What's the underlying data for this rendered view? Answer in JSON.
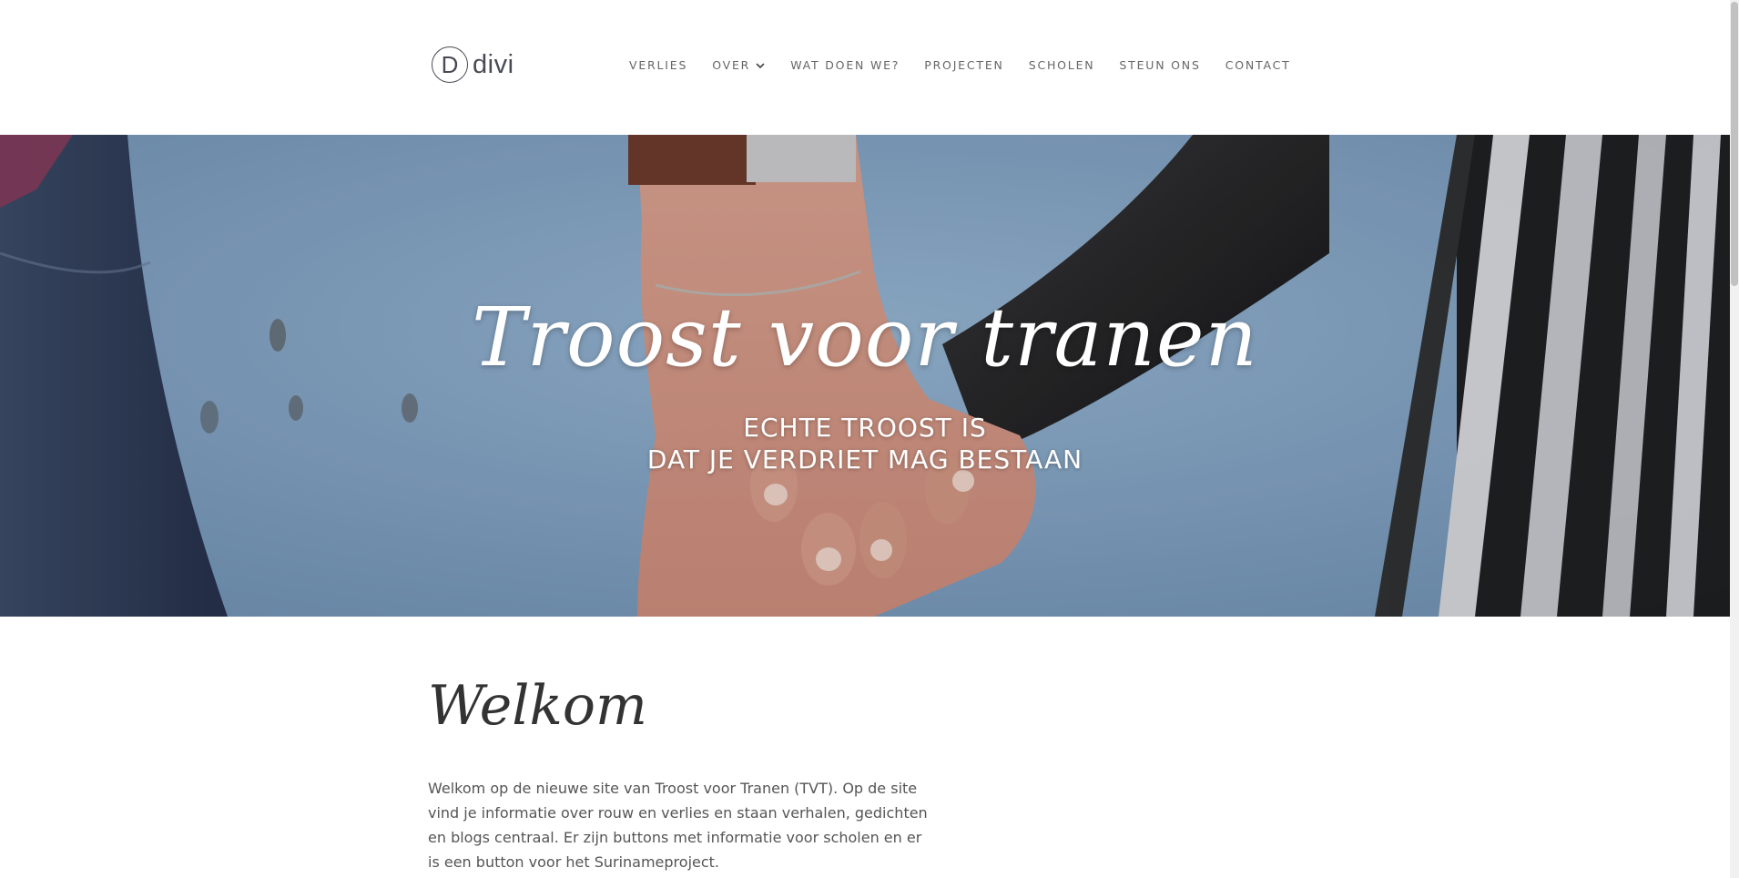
{
  "logo": {
    "letter": "D",
    "text": "divi"
  },
  "nav": {
    "items": [
      {
        "label": "VERLIES"
      },
      {
        "label": "OVER",
        "has_dropdown": true
      },
      {
        "label": "WAT DOEN WE?"
      },
      {
        "label": "PROJECTEN"
      },
      {
        "label": "SCHOLEN"
      },
      {
        "label": "STEUN ONS"
      },
      {
        "label": "CONTACT"
      }
    ]
  },
  "hero": {
    "title": "Troost voor tranen",
    "subtitle_line1": "ECHTE TROOST IS",
    "subtitle_line2": "DAT JE VERDRIET MAG BESTAAN"
  },
  "welcome": {
    "title": "Welkom",
    "lines": [
      "Welkom op de nieuwe site van Troost voor Tranen (TVT).  Op de site",
      "vind je informatie over rouw en verlies en staan verhalen, gedichten",
      "en blogs centraal. Er zijn buttons met informatie voor scholen en er",
      "is een button voor het Surinameproject."
    ]
  },
  "colors": {
    "text_dark": "#333333",
    "nav_text": "#666666",
    "hero_blue": "#86a7c6"
  }
}
